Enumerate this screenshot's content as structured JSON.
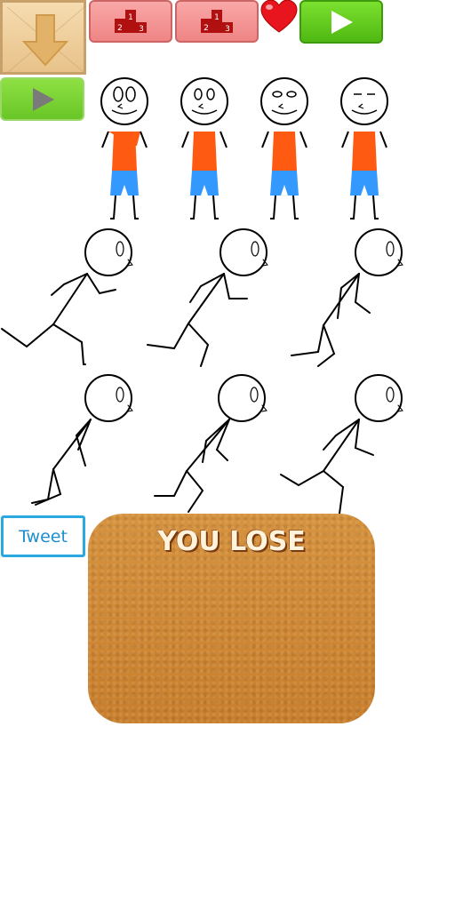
{
  "toolbar": {
    "crate_icon": "down-arrow-icon",
    "leaderboard_buttons": [
      {
        "icon": "podium-icon",
        "places": [
          "1",
          "2",
          "3"
        ]
      },
      {
        "icon": "podium-icon",
        "places": [
          "1",
          "2",
          "3"
        ]
      }
    ],
    "heart_icon": "heart-icon",
    "play_icon": "play-icon"
  },
  "side": {
    "play_icon": "play-icon"
  },
  "characters": {
    "standing_count": 4,
    "running_count": 6,
    "shirt_color": "#ff5a12",
    "shorts_color": "#3399ff"
  },
  "share": {
    "tweet_label": "Tweet"
  },
  "result": {
    "message": "YOU LOSE"
  },
  "colors": {
    "green_button": "#5cc81e",
    "podium_button": "#f29a9a",
    "cork": "#cf8a36",
    "heart": "#e8141e",
    "tweet": "#2aa9e0"
  }
}
